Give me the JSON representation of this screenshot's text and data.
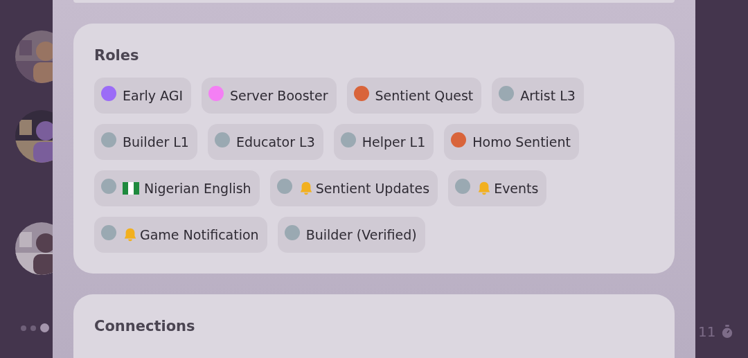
{
  "roles_card": {
    "title": "Roles",
    "roles": [
      {
        "kind": "plain",
        "name": "Early AGI",
        "color": "#9b6cf7"
      },
      {
        "kind": "plain",
        "name": "Server Booster",
        "color": "#f47ff4"
      },
      {
        "kind": "plain",
        "name": "Sentient Quest",
        "color": "#d9643a"
      },
      {
        "kind": "plain",
        "name": "Artist L3",
        "color": "#9aa9b2"
      },
      {
        "kind": "plain",
        "name": "Builder L1",
        "color": "#9aa9b2"
      },
      {
        "kind": "plain",
        "name": "Educator L3",
        "color": "#9aa9b2"
      },
      {
        "kind": "plain",
        "name": "Helper L1",
        "color": "#9aa9b2"
      },
      {
        "kind": "plain",
        "name": "Homo Sentient",
        "color": "#d9643a"
      },
      {
        "kind": "flag",
        "name": "Nigerian English",
        "color": "#9aa9b2"
      },
      {
        "kind": "bell",
        "name": "Sentient Updates",
        "color": "#9aa9b2"
      },
      {
        "kind": "bell",
        "name": "Events",
        "color": "#9aa9b2"
      },
      {
        "kind": "bell",
        "name": "Game Notification",
        "color": "#9aa9b2"
      },
      {
        "kind": "plain",
        "name": "Builder (Verified)",
        "color": "#9aa9b2"
      }
    ]
  },
  "connections_card": {
    "title": "Connections"
  },
  "footer": {
    "count": "11"
  }
}
